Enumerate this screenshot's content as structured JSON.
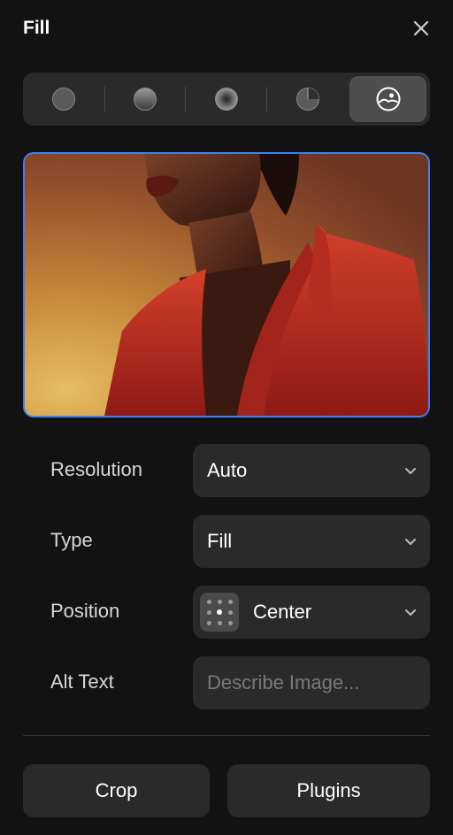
{
  "panel": {
    "title": "Fill"
  },
  "fill_types": [
    {
      "name": "solid",
      "icon": "solid-circle-icon"
    },
    {
      "name": "linear",
      "icon": "linear-gradient-icon"
    },
    {
      "name": "radial",
      "icon": "radial-gradient-icon"
    },
    {
      "name": "conic",
      "icon": "conic-gradient-icon"
    },
    {
      "name": "image",
      "icon": "image-icon",
      "active": true
    }
  ],
  "fields": {
    "resolution": {
      "label": "Resolution",
      "value": "Auto"
    },
    "type": {
      "label": "Type",
      "value": "Fill"
    },
    "position": {
      "label": "Position",
      "value": "Center"
    },
    "alt_text": {
      "label": "Alt Text",
      "placeholder": "Describe Image..."
    }
  },
  "buttons": {
    "crop": "Crop",
    "plugins": "Plugins"
  },
  "colors": {
    "accent": "#3b82f6",
    "background": "#121212",
    "control": "#2a2a2a"
  }
}
